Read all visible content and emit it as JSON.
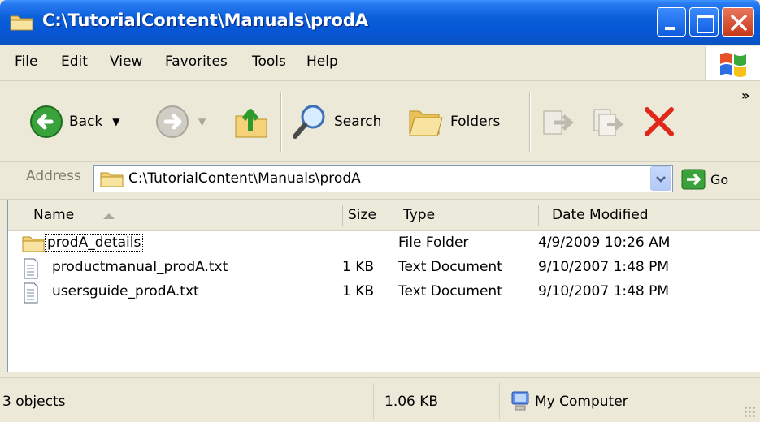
{
  "window": {
    "title": "C:\\TutorialContent\\Manuals\\prodA",
    "icon": "folder-icon"
  },
  "menubar": {
    "items": [
      "File",
      "Edit",
      "View",
      "Favorites",
      "Tools",
      "Help"
    ]
  },
  "toolbar": {
    "back_label": "Back",
    "search_label": "Search",
    "folders_label": "Folders",
    "more_label": "»"
  },
  "address": {
    "label": "Address",
    "value": "C:\\TutorialContent\\Manuals\\prodA",
    "go_label": "Go"
  },
  "columns": [
    "Name",
    "Size",
    "Type",
    "Date Modified"
  ],
  "files": [
    {
      "name": "prodA_details",
      "size": "",
      "type": "File Folder",
      "modified": "4/9/2009 10:26 AM",
      "icon": "folder-icon"
    },
    {
      "name": "productmanual_prodA.txt",
      "size": "1 KB",
      "type": "Text Document",
      "modified": "9/10/2007 1:48 PM",
      "icon": "text-file-icon"
    },
    {
      "name": "usersguide_prodA.txt",
      "size": "1 KB",
      "type": "Text Document",
      "modified": "9/10/2007 1:48 PM",
      "icon": "text-file-icon"
    }
  ],
  "status": {
    "objects": "3 objects",
    "size": "1.06 KB",
    "location": "My Computer"
  },
  "colors": {
    "titlebar": "#0a5fd9",
    "chrome": "#ece9d8",
    "close_button": "#c8381a",
    "delete_x": "#e0281a"
  }
}
